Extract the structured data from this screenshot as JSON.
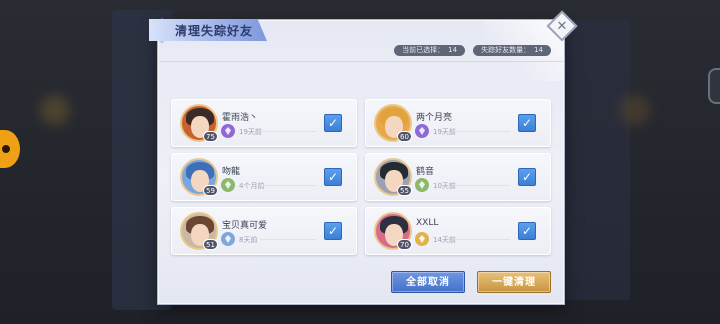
{
  "dialog": {
    "title": "清理失踪好友",
    "close_icon": "close-icon",
    "stats": {
      "selected_label": "当前已选择：",
      "selected_value": "14",
      "missing_label": "失踪好友数量：",
      "missing_value": "14"
    },
    "friends": [
      {
        "name": "霍雨浩丶",
        "level": "75",
        "time": "19天前",
        "rank_color": "#8f6ad6",
        "hair": "#3b2b28",
        "checked": true
      },
      {
        "name": "两个月亮",
        "level": "60",
        "time": "19天前",
        "rank_color": "#8f6ad6",
        "hair": "#e2a23c",
        "checked": true
      },
      {
        "name": "吻龍",
        "level": "59",
        "time": "4个月前",
        "rank_color": "#8bb86a",
        "hair": "#3f6fb6",
        "checked": true
      },
      {
        "name": "鹤音",
        "level": "55",
        "time": "10天前",
        "rank_color": "#8bb86a",
        "hair": "#262a33",
        "checked": true
      },
      {
        "name": "宝贝真可爱",
        "level": "51",
        "time": "8天前",
        "rank_color": "#7fa7d8",
        "hair": "#6b4632",
        "checked": true
      },
      {
        "name": "XXLL",
        "level": "70",
        "time": "14天前",
        "rank_color": "#e3b24a",
        "hair": "#2d3040",
        "checked": true
      }
    ],
    "buttons": {
      "cancel_all": "全部取消",
      "clean_all": "一键清理"
    }
  }
}
